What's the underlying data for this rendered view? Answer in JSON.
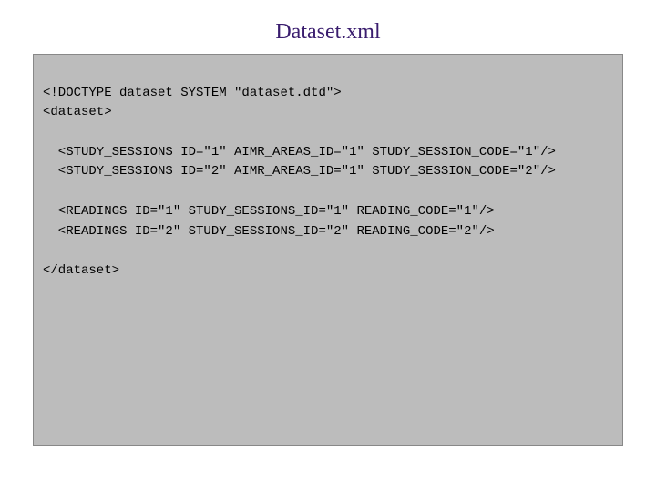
{
  "title": "Dataset.xml",
  "code": {
    "l0": "<!DOCTYPE dataset SYSTEM \"dataset.dtd\">",
    "l1": "<dataset>",
    "l2": "",
    "l3": "  <STUDY_SESSIONS ID=\"1\" AIMR_AREAS_ID=\"1\" STUDY_SESSION_CODE=\"1\"/>",
    "l4": "  <STUDY_SESSIONS ID=\"2\" AIMR_AREAS_ID=\"1\" STUDY_SESSION_CODE=\"2\"/>",
    "l5": "",
    "l6": "  <READINGS ID=\"1\" STUDY_SESSIONS_ID=\"1\" READING_CODE=\"1\"/>",
    "l7": "  <READINGS ID=\"2\" STUDY_SESSIONS_ID=\"2\" READING_CODE=\"2\"/>",
    "l8": "",
    "l9": "</dataset>"
  }
}
